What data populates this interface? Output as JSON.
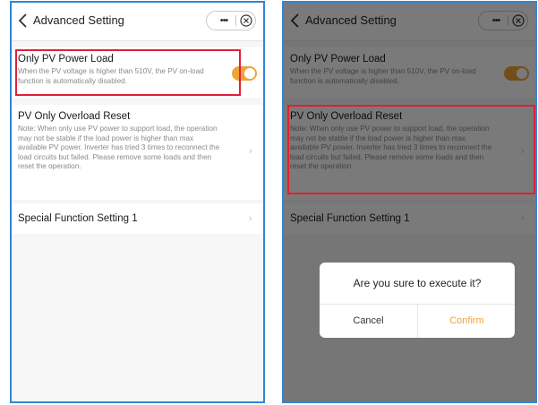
{
  "header": {
    "title": "Advanced Setting",
    "more_glyph": "•••"
  },
  "items": [
    {
      "title": "Only PV Power Load",
      "desc": "When the PV voltage is higher than 510V, the PV on-load function is automatically disabled.",
      "toggle_on": true
    },
    {
      "title": "PV Only Overload Reset",
      "desc": "Note:  When only use PV power to support load, the operation may not be stable if the load power is higher than max available PV power. Inverter has tried 3 times to reconnect the load circuits but failed. Please remove some loads and then reset the operation."
    },
    {
      "title": "Special Function Setting 1"
    }
  ],
  "dialog": {
    "message": "Are you sure to execute it?",
    "cancel": "Cancel",
    "confirm": "Confirm"
  },
  "colors": {
    "frame": "#2f86d8",
    "highlight": "#e02035",
    "accent": "#f0a33a"
  }
}
